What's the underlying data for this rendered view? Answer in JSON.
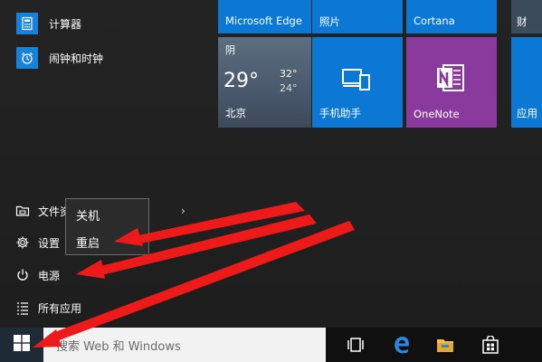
{
  "apps": [
    {
      "label": "计算器",
      "icon": "calculator-icon"
    },
    {
      "label": "闹钟和时钟",
      "icon": "alarm-clock-icon"
    }
  ],
  "left_menu": {
    "file_explorer": "文件资",
    "settings": "设置",
    "power": "电源",
    "all_apps": "所有应用",
    "chevron": "›"
  },
  "power_flyout": {
    "shutdown": "关机",
    "restart": "重启"
  },
  "tiles": {
    "edge": "Microsoft Edge",
    "photos": "照片",
    "cortana": "Cortana",
    "weather": {
      "condition": "阴",
      "temp": "29°",
      "high": "32°",
      "low": "24°",
      "city": "北京"
    },
    "phone": "手机助手",
    "onenote": "OneNote",
    "partial_top_right": "财",
    "partial_mid_right": "应用"
  },
  "taskbar": {
    "search_placeholder": "搜索 Web 和 Windows",
    "icons": [
      "task-view-icon",
      "edge-icon",
      "file-explorer-icon",
      "store-icon"
    ]
  },
  "colors": {
    "tile_blue": "#0a78d4",
    "onenote_purple": "#8a3a9c",
    "arrow_red": "#ee1a1a"
  }
}
